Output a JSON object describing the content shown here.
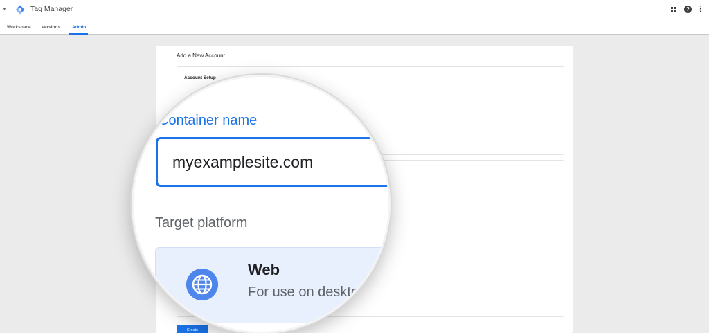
{
  "app": {
    "title": "Tag Manager",
    "brand_color": "#1a73e8"
  },
  "header": {
    "icons": [
      "caret-down-icon",
      "tag-manager-logo-icon",
      "apps-grid-icon",
      "help-icon",
      "more-vert-icon"
    ],
    "help_glyph": "?",
    "more_glyph": "⋮",
    "caret_glyph": "▼"
  },
  "tabs": [
    {
      "label": "Workspace",
      "active": false
    },
    {
      "label": "Versions",
      "active": false
    },
    {
      "label": "Admin",
      "active": true
    }
  ],
  "page": {
    "title": "Add a New Account",
    "account_setup": {
      "title": "Account Setup"
    },
    "actions": {
      "create_label": "Create"
    }
  },
  "magnified": {
    "container_label": "Container name",
    "container_value": "myexamplesite.com",
    "target_platform_label": "Target platform",
    "platform": {
      "name": "Web",
      "description": "For use on desktop and mobile web pages",
      "icon": "globe-icon"
    }
  }
}
